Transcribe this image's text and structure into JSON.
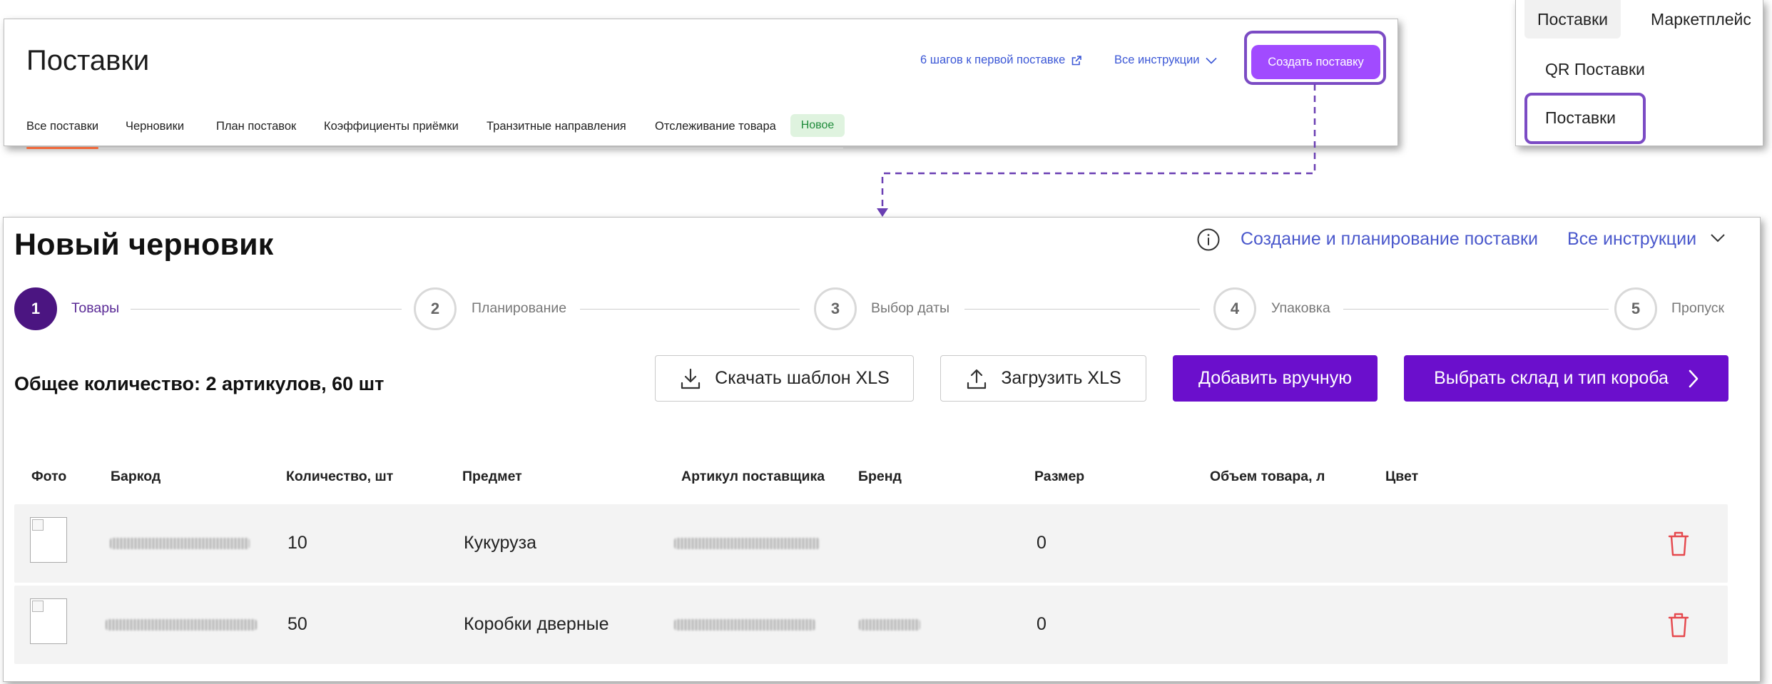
{
  "top_panel": {
    "title": "Поставки",
    "tabs": [
      "Все поставки",
      "Черновики",
      "План поставок",
      "Коэффициенты приёмки",
      "Транзитные направления",
      "Отслеживание товара"
    ],
    "new_badge": "Новое",
    "steps_link": "6 шагов к первой поставке",
    "instructions_link": "Все инструкции",
    "create_button": "Создать поставку"
  },
  "menu": {
    "tabs": [
      "Поставки",
      "Маркетплейс"
    ],
    "items": [
      "QR Поставки",
      "Поставки"
    ]
  },
  "draft": {
    "title": "Новый черновик",
    "help_link": "Создание и планирование поставки",
    "instructions_link": "Все инструкции",
    "steps": [
      {
        "num": "1",
        "label": "Товары"
      },
      {
        "num": "2",
        "label": "Планирование"
      },
      {
        "num": "3",
        "label": "Выбор даты"
      },
      {
        "num": "4",
        "label": "Упаковка"
      },
      {
        "num": "5",
        "label": "Пропуск"
      }
    ],
    "summary": "Общее количество: 2 артикулов, 60 шт",
    "buttons": {
      "download_template": "Скачать шаблон XLS",
      "upload": "Загрузить XLS",
      "add_manual": "Добавить вручную",
      "choose_warehouse": "Выбрать склад и тип короба"
    },
    "table": {
      "columns": [
        "Фото",
        "Баркод",
        "Количество, шт",
        "Предмет",
        "Артикул поставщика",
        "Бренд",
        "Размер",
        "Объем товара, л",
        "Цвет"
      ],
      "rows": [
        {
          "quantity": "10",
          "subject": "Кукуруза",
          "size": "0"
        },
        {
          "quantity": "50",
          "subject": "Коробки дверные",
          "size": "0"
        }
      ]
    }
  },
  "colors": {
    "accent_purple": "#6b0fcc",
    "create_button": "#a14bff",
    "highlight_border": "#7b4bc4",
    "active_step": "#4b1581",
    "tab_underline": "#f0683a",
    "link_blue": "#3b57d6",
    "delete_red": "#e5484d"
  },
  "icons": [
    "external-link-icon",
    "chevron-down-icon",
    "info-icon",
    "download-icon",
    "upload-icon",
    "chevron-right-icon",
    "trash-icon",
    "photo-placeholder-icon"
  ]
}
